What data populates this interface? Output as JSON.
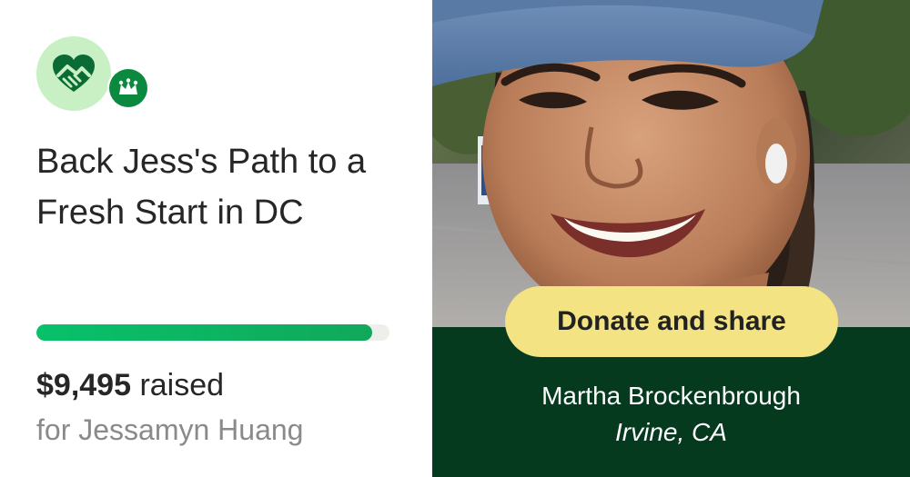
{
  "campaign": {
    "title": "Back Jess's Path to a Fresh Start in DC",
    "raised_amount": "$9,495",
    "raised_suffix": " raised",
    "beneficiary": "for Jessamyn Huang",
    "progress_fraction": 0.95
  },
  "cta": {
    "label": "Donate and share"
  },
  "sharer": {
    "name": "Martha Brockenbrough",
    "location": "Irvine, CA"
  },
  "icons": {
    "logo": "heart-handshake-icon",
    "badge": "crown-icon"
  },
  "colors": {
    "accent_green": "#0b8a3f",
    "progress_green": "#08c16a",
    "cta_yellow": "#f3e382",
    "dark_green": "#053a1f"
  }
}
